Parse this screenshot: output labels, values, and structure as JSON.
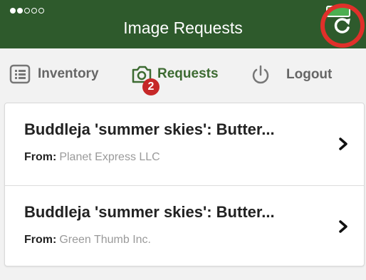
{
  "status_bar": {
    "signal_filled": 2,
    "signal_total": 5
  },
  "header": {
    "title": "Image Requests",
    "refresh_icon": "refresh-icon"
  },
  "tabs": [
    {
      "label": "Inventory",
      "icon": "list-icon",
      "active": false
    },
    {
      "label": "Requests",
      "icon": "camera-icon",
      "active": true,
      "badge": "2"
    },
    {
      "label": "Logout",
      "icon": "power-icon",
      "active": false
    }
  ],
  "requests": [
    {
      "title": "Buddleja 'summer skies': Butter...",
      "from_label": "From:",
      "from_value": "Planet Express LLC"
    },
    {
      "title": "Buddleja 'summer skies': Butter...",
      "from_label": "From:",
      "from_value": "Green Thumb Inc."
    }
  ],
  "colors": {
    "header_bg": "#2e5a2c",
    "accent": "#3d6b32",
    "badge": "#c62828",
    "highlight_ring": "#e0302a"
  }
}
